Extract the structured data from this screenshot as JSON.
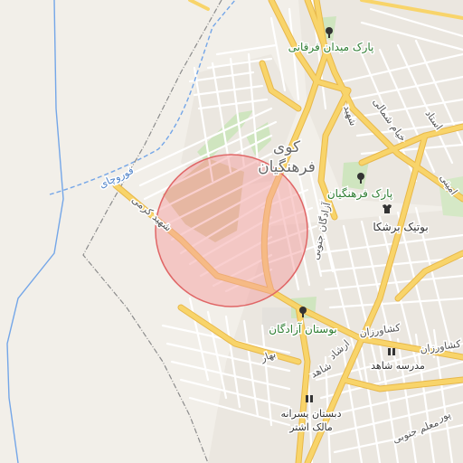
{
  "map": {
    "labels": {
      "park_meydan_forghani": "پارک میدان فرقانی",
      "kuy_line1": "کوی",
      "kuy_line2": "فرهنگیان",
      "park_farhangian": "پارک فرهنگیان",
      "boutique_barshoka": "بوتیک برشکا",
      "bustan_azadegan": "بوستان آزادگان",
      "madrese_shahed": "مدرسه شاهد",
      "dabestan_line1": "دبستان پسرانه",
      "dabestan_line2": "مالک اشتر",
      "river_foroochay": "فوروچای",
      "street_keshavarzan_1": "کشاورزان",
      "street_keshavarzan_2": "کشاورزان",
      "street_azadegan_south": "آزادگان جنوبی",
      "street_khayyam_north": "خیام شمالی",
      "street_shahid_kerami": "شهید کرمی",
      "street_ershad": "ارشاد",
      "street_shahed": "شاهد",
      "street_bahar": "بهار",
      "street_moallem_south": "معلم جنوبی",
      "street_pour": "پور",
      "street_ostad": "استاد",
      "street_amini": "امینی",
      "street_shahid": "شهید"
    },
    "icons": {
      "park": "tree-icon",
      "boutique": "shirt-icon",
      "school": "school-icon"
    },
    "colors": {
      "land": "#f2efe9",
      "road_major": "#f8d46a",
      "road_minor": "#ffffff",
      "water": "#74a6e8",
      "park": "#cfe5bf",
      "highlight_fill": "#f4a0a0",
      "highlight_stroke": "#e06666",
      "boundary": "#8c8c8c",
      "label_text": "#555555"
    }
  }
}
